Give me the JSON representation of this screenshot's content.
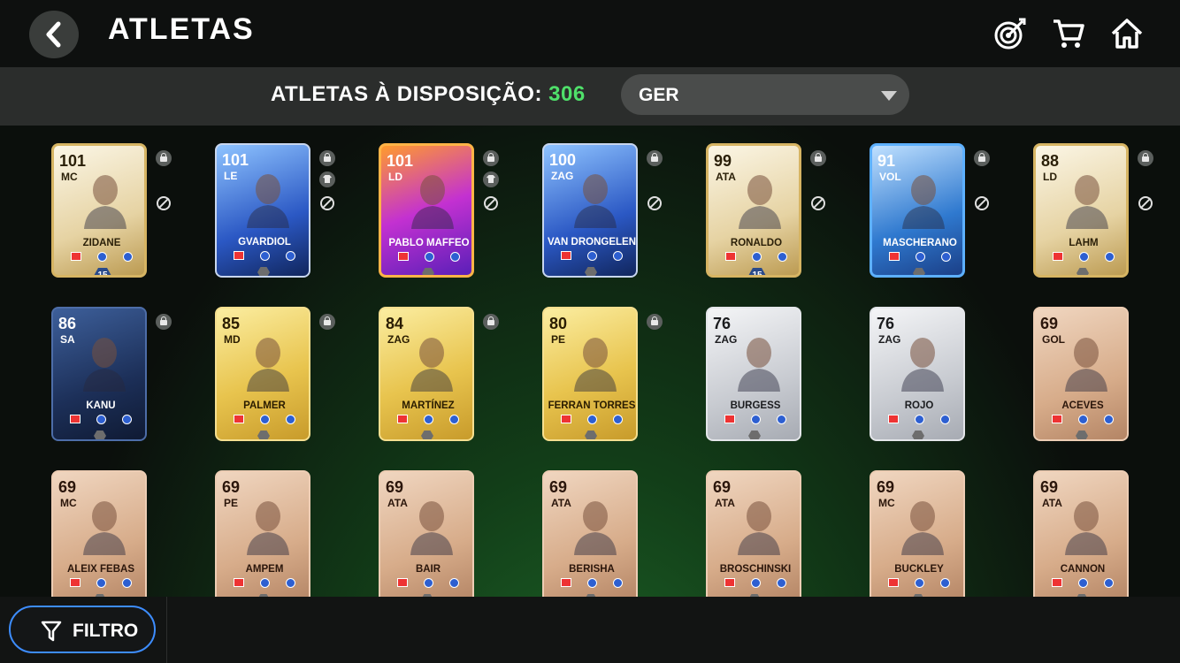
{
  "header": {
    "title": "ATLETAS",
    "icons": [
      "back-chevron-icon",
      "target-icon",
      "cart-icon",
      "home-icon"
    ]
  },
  "summary": {
    "available_label": "ATLETAS À DISPOSIÇÃO:",
    "available_count": "306",
    "dropdown_value": "GER"
  },
  "filter": {
    "label": "FILTRO"
  },
  "colors": {
    "accent_green": "#4fe06a",
    "filter_border": "#3d8dff"
  },
  "cards": [
    {
      "rating": "101",
      "position": "MC",
      "name": "ZIDANE",
      "style": "icon",
      "lock": true,
      "untradeable": true,
      "badge": "15"
    },
    {
      "rating": "101",
      "position": "LE",
      "name": "GVARDIOL",
      "style": "toty",
      "lock": true,
      "shirt": true,
      "untradeable": true
    },
    {
      "rating": "101",
      "position": "LD",
      "name": "PABLO MAFFEO",
      "style": "fest",
      "lock": true,
      "shirt": true,
      "untradeable": true
    },
    {
      "rating": "100",
      "position": "ZAG",
      "name": "VAN DRONGELEN",
      "style": "toty",
      "lock": true,
      "untradeable": true
    },
    {
      "rating": "99",
      "position": "ATA",
      "name": "RONALDO",
      "style": "icon",
      "lock": true,
      "untradeable": true,
      "badge": "15"
    },
    {
      "rating": "91",
      "position": "VOL",
      "name": "MASCHERANO",
      "style": "blue",
      "lock": true,
      "untradeable": true
    },
    {
      "rating": "88",
      "position": "LD",
      "name": "LAHM",
      "style": "icon",
      "lock": true,
      "untradeable": true
    },
    {
      "rating": "86",
      "position": "SA",
      "name": "KANU",
      "style": "navy",
      "lock": true
    },
    {
      "rating": "85",
      "position": "MD",
      "name": "PALMER",
      "style": "gold",
      "lock": true
    },
    {
      "rating": "84",
      "position": "ZAG",
      "name": "MARTÍNEZ",
      "style": "gold",
      "lock": true
    },
    {
      "rating": "80",
      "position": "PE",
      "name": "FERRAN TORRES",
      "style": "gold",
      "lock": true
    },
    {
      "rating": "76",
      "position": "ZAG",
      "name": "BURGESS",
      "style": "silver"
    },
    {
      "rating": "76",
      "position": "ZAG",
      "name": "ROJO",
      "style": "silver"
    },
    {
      "rating": "69",
      "position": "GOL",
      "name": "ACEVES",
      "style": "bronze"
    },
    {
      "rating": "69",
      "position": "MC",
      "name": "ALEIX FEBAS",
      "style": "bronze"
    },
    {
      "rating": "69",
      "position": "PE",
      "name": "AMPEM",
      "style": "bronze"
    },
    {
      "rating": "69",
      "position": "ATA",
      "name": "BAIR",
      "style": "bronze"
    },
    {
      "rating": "69",
      "position": "ATA",
      "name": "BERISHA",
      "style": "bronze"
    },
    {
      "rating": "69",
      "position": "ATA",
      "name": "BROSCHINSKI",
      "style": "bronze"
    },
    {
      "rating": "69",
      "position": "MC",
      "name": "BUCKLEY",
      "style": "bronze"
    },
    {
      "rating": "69",
      "position": "ATA",
      "name": "CANNON",
      "style": "bronze"
    }
  ]
}
